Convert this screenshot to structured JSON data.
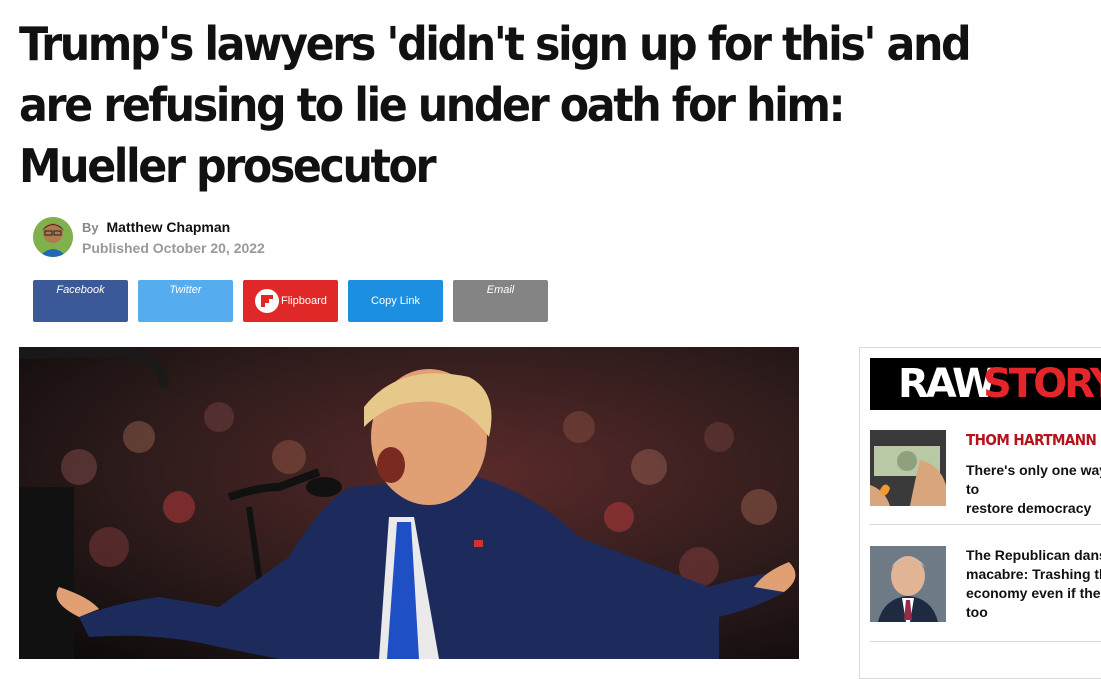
{
  "article": {
    "headline": "Trump's lawyers 'didn't sign up for this' and are refusing to lie under oath for him: Mueller prosecutor",
    "byline_prefix": "By",
    "author": "Matthew Chapman",
    "published": "Published October 20, 2022"
  },
  "share": {
    "facebook": "Facebook",
    "twitter": "Twitter",
    "flipboard": "Flipboard",
    "copy_link": "Copy Link",
    "email": "Email"
  },
  "colors": {
    "facebook": "#3b5998",
    "twitter": "#55acee",
    "flipboard": "#e12828",
    "copy_link": "#1d8fe1",
    "email": "#848484",
    "brand_red": "#e4262b",
    "kicker_red": "#b5121b"
  },
  "sidebar": {
    "logo_part1": "RAW",
    "logo_part2": "STORY",
    "stories": [
      {
        "kicker": "THOM HARTMANN",
        "title": "There's only one way to\nrestore democracy"
      },
      {
        "kicker": "",
        "title": "The Republican danse\nmacabre: Trashing the\neconomy even if they\ntoo"
      }
    ]
  }
}
